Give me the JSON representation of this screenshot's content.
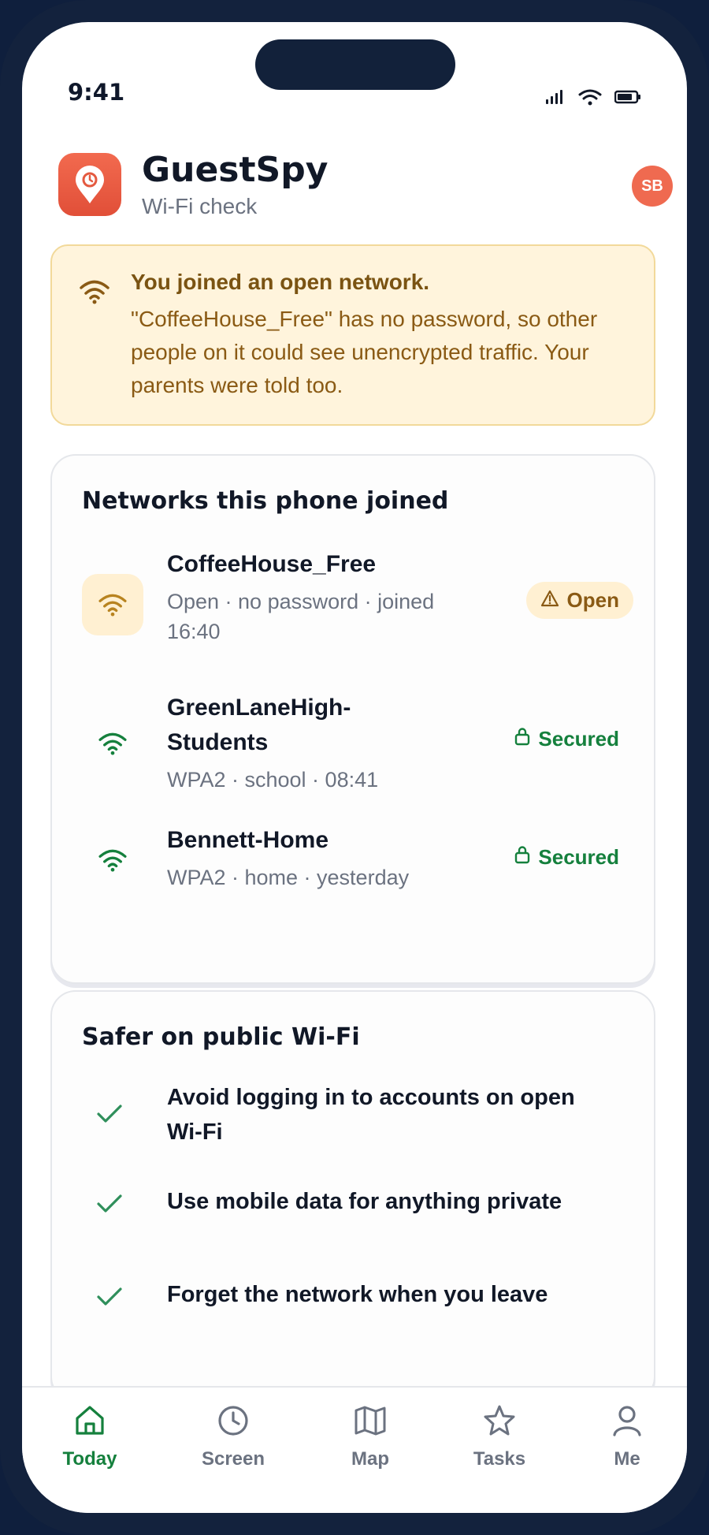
{
  "status_bar": {
    "time": "9:41",
    "icons": [
      "signal-icon",
      "wifi-icon",
      "battery-icon"
    ]
  },
  "header": {
    "app_name": "GuestSpy",
    "subtitle": "Wi-Fi check",
    "avatar_initials": "SB",
    "app_icon": "location-pin-icon"
  },
  "alert": {
    "title": "You joined an open network.",
    "body": "\"CoffeeHouse_Free\" has no password, so other people on it could see unencrypted traffic. Your parents were told too.",
    "icon": "wifi-icon"
  },
  "networks": {
    "title": "Networks this phone joined",
    "items": [
      {
        "name": "CoffeeHouse_Free",
        "meta": "Open · no password · joined 16:40",
        "badge": "Open",
        "status": "open",
        "badge_icon": "warning-icon"
      },
      {
        "name": "GreenLaneHigh-Students",
        "meta": "WPA2 · school · 08:41",
        "badge": "Secured",
        "status": "secured",
        "badge_icon": "lock-icon"
      },
      {
        "name": "Bennett-Home",
        "meta": "WPA2 · home · yesterday",
        "badge": "Secured",
        "status": "secured",
        "badge_icon": "lock-icon"
      }
    ]
  },
  "tips": {
    "title": "Safer on public Wi-Fi",
    "items": [
      {
        "text": "Avoid logging in to accounts on open Wi-Fi"
      },
      {
        "text": "Use mobile data for anything private"
      },
      {
        "text": "Forget the network when you leave"
      }
    ]
  },
  "tabbar": {
    "items": [
      {
        "label": "Today",
        "icon": "home-icon",
        "active": true
      },
      {
        "label": "Screen",
        "icon": "clock-icon",
        "active": false
      },
      {
        "label": "Map",
        "icon": "map-icon",
        "active": false
      },
      {
        "label": "Tasks",
        "icon": "star-icon",
        "active": false
      },
      {
        "label": "Me",
        "icon": "user-icon",
        "active": false
      }
    ]
  },
  "colors": {
    "accent": "#15803d",
    "brand": "#ef6a50",
    "warning_bg": "#fff4dc",
    "warning_text": "#8a5a14"
  }
}
